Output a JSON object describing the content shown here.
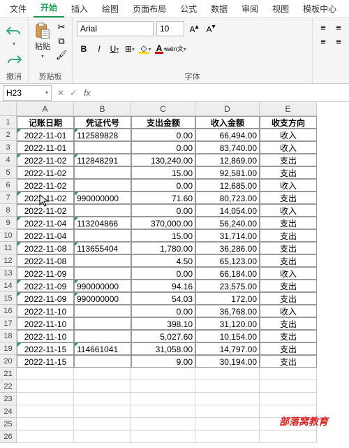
{
  "tabs": [
    "文件",
    "开始",
    "插入",
    "绘图",
    "页面布局",
    "公式",
    "数据",
    "审阅",
    "视图",
    "模板中心"
  ],
  "active_tab": 1,
  "groups": {
    "undo": "撤消",
    "clipboard": "剪贴板",
    "paste": "粘贴",
    "font": "字体"
  },
  "font": {
    "name": "Arial",
    "size": "10",
    "wen": "wén",
    "wen2": "文"
  },
  "namebox": "H23",
  "formula": "",
  "headers": [
    "记账日期",
    "凭证代号",
    "支出金额",
    "收入金额",
    "收支方向"
  ],
  "rows": [
    {
      "a": "2022-11-01",
      "b": "112589828",
      "c": "0.00",
      "d": "66,494.00",
      "e": "收入",
      "gm": true
    },
    {
      "a": "2022-11-01",
      "b": "",
      "c": "0.00",
      "d": "83,740.00",
      "e": "收入",
      "gm": false
    },
    {
      "a": "2022-11-02",
      "b": "112848291",
      "c": "130,240.00",
      "d": "12,869.00",
      "e": "支出",
      "gm": true
    },
    {
      "a": "2022-11-02",
      "b": "",
      "c": "15.00",
      "d": "92,581.00",
      "e": "支出",
      "gm": false
    },
    {
      "a": "2022-11-02",
      "b": "",
      "c": "0.00",
      "d": "12,685.00",
      "e": "收入",
      "gm": false
    },
    {
      "a": "2022-11-02",
      "b": "990000000",
      "c": "71.60",
      "d": "80,723.00",
      "e": "支出",
      "gm": true
    },
    {
      "a": "2022-11-02",
      "b": "",
      "c": "0.00",
      "d": "14,054.00",
      "e": "收入",
      "gm": false
    },
    {
      "a": "2022-11-04",
      "b": "113204866",
      "c": "370,000.00",
      "d": "56,240.00",
      "e": "支出",
      "gm": true
    },
    {
      "a": "2022-11-04",
      "b": "",
      "c": "15.00",
      "d": "31,714.00",
      "e": "支出",
      "gm": false
    },
    {
      "a": "2022-11-08",
      "b": "113655404",
      "c": "1,780.00",
      "d": "36,286.00",
      "e": "支出",
      "gm": true
    },
    {
      "a": "2022-11-08",
      "b": "",
      "c": "4.50",
      "d": "65,123.00",
      "e": "支出",
      "gm": false
    },
    {
      "a": "2022-11-09",
      "b": "",
      "c": "0.00",
      "d": "66,184.00",
      "e": "收入",
      "gm": false
    },
    {
      "a": "2022-11-09",
      "b": "990000000",
      "c": "94.16",
      "d": "23,575.00",
      "e": "支出",
      "gm": true
    },
    {
      "a": "2022-11-09",
      "b": "990000000",
      "c": "54.03",
      "d": "172.00",
      "e": "支出",
      "gm": true
    },
    {
      "a": "2022-11-10",
      "b": "",
      "c": "0.00",
      "d": "36,768.00",
      "e": "收入",
      "gm": false
    },
    {
      "a": "2022-11-10",
      "b": "",
      "c": "398.10",
      "d": "31,120.00",
      "e": "支出",
      "gm": false
    },
    {
      "a": "2022-11-10",
      "b": "",
      "c": "5,027.60",
      "d": "10,154.00",
      "e": "支出",
      "gm": false
    },
    {
      "a": "2022-11-15",
      "b": "114661041",
      "c": "31,058.00",
      "d": "14,797.00",
      "e": "支出",
      "gm": true
    },
    {
      "a": "2022-11-15",
      "b": "",
      "c": "9.00",
      "d": "30,194.00",
      "e": "支出",
      "gm": false
    }
  ],
  "empty_rows": [
    21,
    22,
    23,
    24,
    25,
    26
  ],
  "watermark": "部落窝教育",
  "chart_data": {
    "type": "table",
    "title": "",
    "columns": [
      "记账日期",
      "凭证代号",
      "支出金额",
      "收入金额",
      "收支方向"
    ],
    "data": [
      [
        "2022-11-01",
        "112589828",
        0.0,
        66494.0,
        "收入"
      ],
      [
        "2022-11-01",
        "",
        0.0,
        83740.0,
        "收入"
      ],
      [
        "2022-11-02",
        "112848291",
        130240.0,
        12869.0,
        "支出"
      ],
      [
        "2022-11-02",
        "",
        15.0,
        92581.0,
        "支出"
      ],
      [
        "2022-11-02",
        "",
        0.0,
        12685.0,
        "收入"
      ],
      [
        "2022-11-02",
        "990000000",
        71.6,
        80723.0,
        "支出"
      ],
      [
        "2022-11-02",
        "",
        0.0,
        14054.0,
        "收入"
      ],
      [
        "2022-11-04",
        "113204866",
        370000.0,
        56240.0,
        "支出"
      ],
      [
        "2022-11-04",
        "",
        15.0,
        31714.0,
        "支出"
      ],
      [
        "2022-11-08",
        "113655404",
        1780.0,
        36286.0,
        "支出"
      ],
      [
        "2022-11-08",
        "",
        4.5,
        65123.0,
        "支出"
      ],
      [
        "2022-11-09",
        "",
        0.0,
        66184.0,
        "收入"
      ],
      [
        "2022-11-09",
        "990000000",
        94.16,
        23575.0,
        "支出"
      ],
      [
        "2022-11-09",
        "990000000",
        54.03,
        172.0,
        "支出"
      ],
      [
        "2022-11-10",
        "",
        0.0,
        36768.0,
        "收入"
      ],
      [
        "2022-11-10",
        "",
        398.1,
        31120.0,
        "支出"
      ],
      [
        "2022-11-10",
        "",
        5027.6,
        10154.0,
        "支出"
      ],
      [
        "2022-11-15",
        "114661041",
        31058.0,
        14797.0,
        "支出"
      ],
      [
        "2022-11-15",
        "",
        9.0,
        30194.0,
        "支出"
      ]
    ]
  }
}
